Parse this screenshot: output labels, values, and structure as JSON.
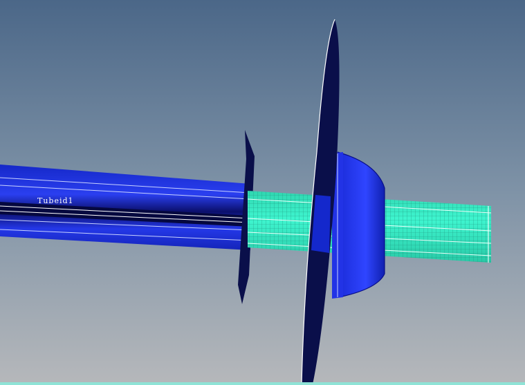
{
  "viewport": {
    "label": "Tubeid1",
    "colors": {
      "background_top": "#4b6788",
      "background_bottom": "#b6b8bb",
      "tube_dark": "#0b0f6b",
      "tube_blue": "#1f2fe6",
      "tube_light": "#3a56ff",
      "mesh_green": "#38f0c8",
      "mesh_grid": "#1b8f7a",
      "plate_dark": "#0a0f4a",
      "edge_white": "#ffffff",
      "bottom_edge": "#8fe3d6"
    }
  }
}
